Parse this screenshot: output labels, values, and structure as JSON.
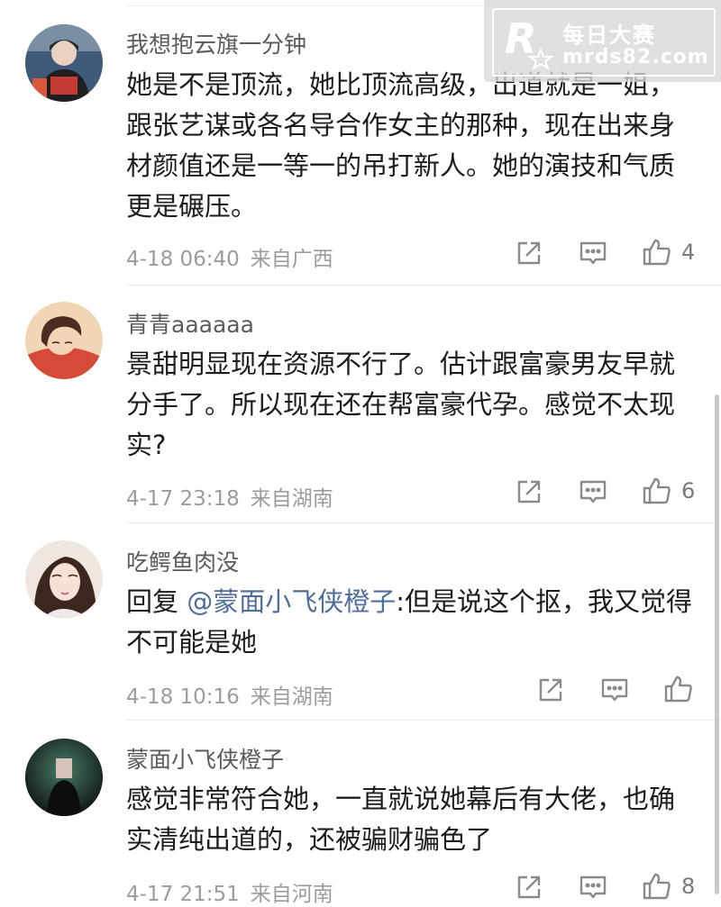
{
  "watermark": {
    "brand_cn": "每日大赛",
    "url": "mrds82.com"
  },
  "comments": [
    {
      "username": "我想抱云旗一分钟",
      "avatar": "avatar-user-1",
      "text": "她是不是顶流，她比顶流高级，出道就是一姐，跟张艺谋或各名导合作女主的那种，现在出来身材颜值还是一等一的吊打新人。她的演技和气质更是碾压。",
      "time": "4-18 06:40",
      "location": "来自广西",
      "likes": "4"
    },
    {
      "username": "青青aaaaaa",
      "avatar": "avatar-user-2",
      "text": "景甜明显现在资源不行了。估计跟富豪男友早就分手了。所以现在还在帮富豪代孕。感觉不太现实?",
      "time": "4-17 23:18",
      "location": "来自湖南",
      "likes": "6"
    },
    {
      "username": "吃鳄鱼肉没",
      "avatar": "avatar-user-3",
      "reply_prefix": "回复",
      "mention": "@蒙面小飞侠橙子",
      "text": ":但是说这个抠，我又觉得不可能是她",
      "time": "4-18 10:16",
      "location": "来自湖南",
      "likes": ""
    },
    {
      "username": "蒙面小飞侠橙子",
      "avatar": "avatar-user-4",
      "text": "感觉非常符合她，一直就说她幕后有大佬，也确实清纯出道的，还被骗财骗色了",
      "time": "4-17 21:51",
      "location": "来自河南",
      "likes": "8"
    }
  ],
  "icons": {
    "share": "share-icon",
    "reply": "comment-icon",
    "like": "thumbs-up-icon"
  },
  "colors": {
    "username": "#5b5b5b",
    "text": "#1c1c1c",
    "meta": "#9c9c9c",
    "mention": "#4f6e99"
  }
}
